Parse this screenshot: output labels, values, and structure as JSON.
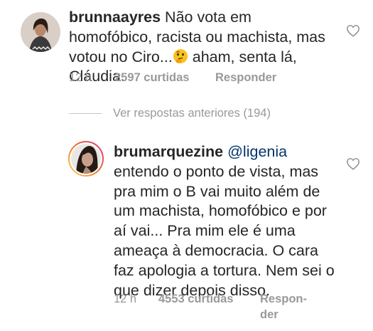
{
  "comments": [
    {
      "username": "brunnaayres",
      "text_before_emoji": "Não vota em homofóbico, racista ou machista, mas votou no Ciro...",
      "emoji": "thinking-face-emoji",
      "text_after_emoji": " aham, senta lá, Cláudia.",
      "time": "12 h",
      "likes": "2597 curtidas",
      "reply_label": "Responder"
    }
  ],
  "view_previous": "Ver respostas anteriores (194)",
  "reply": {
    "username": "brumarquezine",
    "mention": "@ligenia",
    "text": "entendo o ponto de vista, mas pra mim o B vai muito além de um machista, homofóbico e por aí vai... Pra mim ele é uma ameaça à democracia. O cara faz apologia a tortura. Nem sei o que dizer depois disso.",
    "time": "12 h",
    "likes": "4553 curtidas",
    "reply_label_line1": "Respon-",
    "reply_label_line2": "der"
  },
  "icons": {
    "like": "heart-outline-icon",
    "avatar_ring": "story-ring"
  },
  "colors": {
    "text": "#262626",
    "meta": "#999999",
    "mention": "#003569",
    "heart": "#8e8e8e",
    "story_ring_start": "#f58529",
    "story_ring_end": "#dd2a7b"
  }
}
